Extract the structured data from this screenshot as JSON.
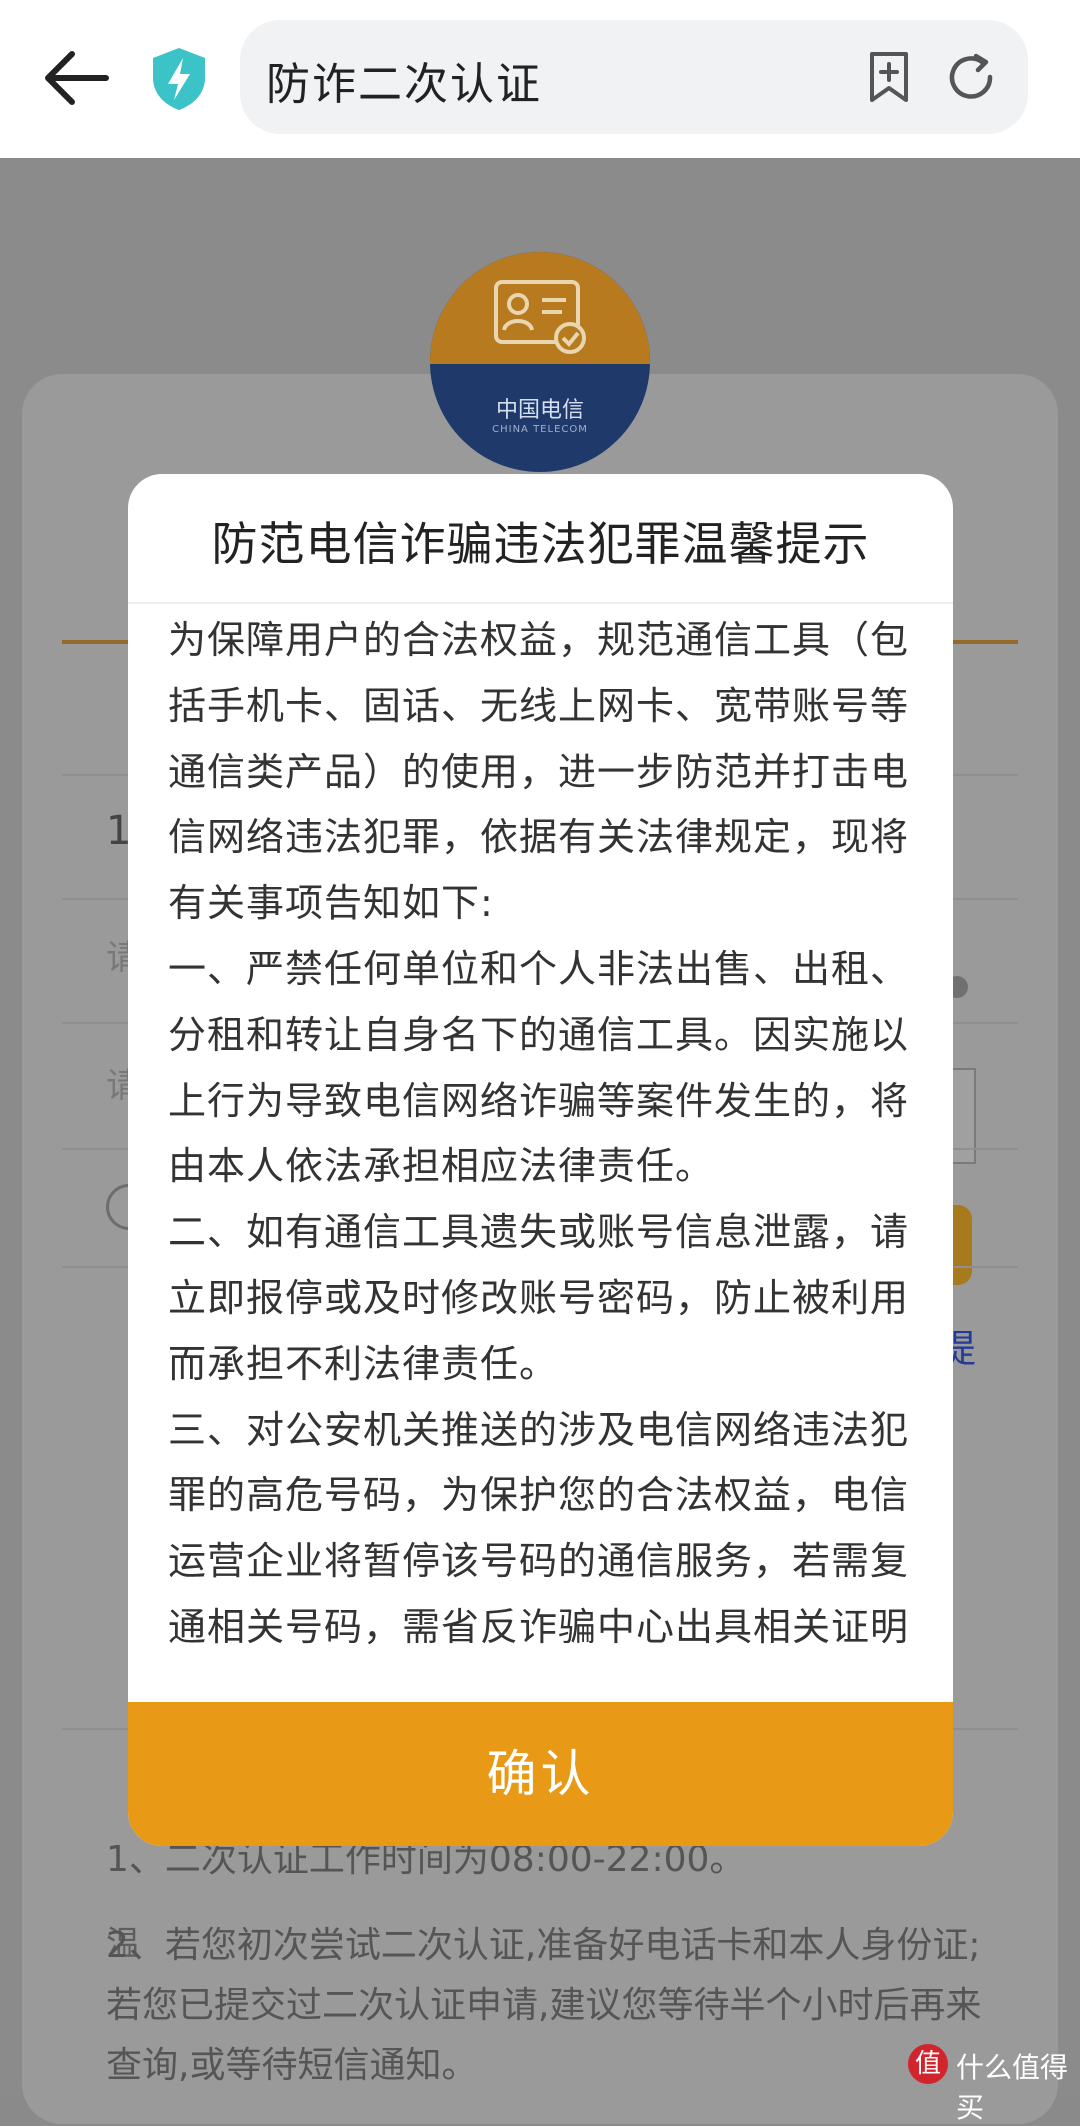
{
  "browser": {
    "title": "防诈二次认证"
  },
  "logo": {
    "brand_cn": "中国电信",
    "brand_en": "CHINA TELECOM"
  },
  "background": {
    "phone_prefix": "1",
    "input1_hint": "请",
    "input2_hint": "请",
    "link_partial": "提",
    "tips_title": "温",
    "tips": [
      "1、二次认证工作时间为08:00-22:00。",
      "2、若您初次尝试二次认证,准备好电话卡和本人身份证;若您已提交过二次认证申请,建议您等待半个小时后再来查询,或等待短信通知。"
    ]
  },
  "modal": {
    "title": "防范电信诈骗违法犯罪温馨提示",
    "paragraphs": [
      "为保障用户的合法权益，规范通信工具（包括手机卡、固话、无线上网卡、宽带账号等通信类产品）的使用，进一步防范并打击电信网络违法犯罪，依据有关法律规定，现将有关事项告知如下:",
      "一、严禁任何单位和个人非法出售、出租、分租和转让自身名下的通信工具。因实施以上行为导致电信网络诈骗等案件发生的，将由本人依法承担相应法律责任。",
      "二、如有通信工具遗失或账号信息泄露，请立即报停或及时修改账号密码，防止被利用而承担不利法律责任。",
      "三、对公安机关推送的涉及电信网络违法犯罪的高危号码，为保护您的合法权益，电信运营企业将暂停该号码的通信服务，若需复通相关号码，需省反诈骗中心出具相关证明后办理。"
    ],
    "confirm_label": "确认"
  },
  "watermark": {
    "icon_char": "值",
    "text": "什么值得买"
  },
  "colors": {
    "accent": "#e89a17",
    "shield": "#3cc3c8"
  }
}
